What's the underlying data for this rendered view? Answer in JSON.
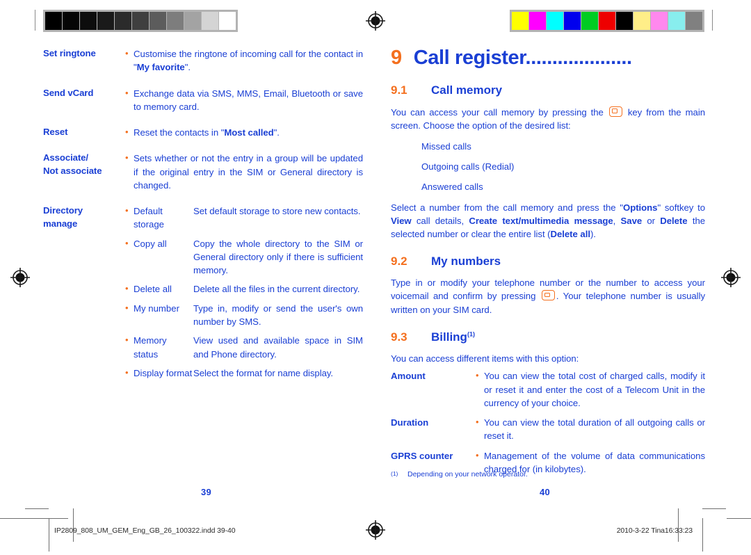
{
  "document": {
    "type": "print-proof-spread",
    "left_page_number": "39",
    "right_page_number": "40"
  },
  "calibration": {
    "grayscale_label": "grayscale-calibration-strip",
    "grayscale_swatches": [
      "#000000",
      "#050505",
      "#0d0d0d",
      "#1a1a1a",
      "#2b2b2b",
      "#3f3f3f",
      "#5c5c5c",
      "#7d7d7d",
      "#a3a3a3",
      "#d4d4d4",
      "#ffffff"
    ],
    "color_label": "color-calibration-strip",
    "color_swatches": [
      "#ffff00",
      "#ff00ff",
      "#00ffff",
      "#0000ee",
      "#00cc22",
      "#ee0000",
      "#000000",
      "#ffee88",
      "#ff88ee",
      "#88eeee",
      "#808080"
    ]
  },
  "left_page": {
    "rows": [
      {
        "term": [
          "Set ringtone"
        ],
        "bullets": [
          {
            "text_html": "Customise the ringtone of incoming call for the contact in \"<b>My favorite</b>\"."
          }
        ]
      },
      {
        "term": [
          "Send vCard"
        ],
        "bullets": [
          {
            "text_html": "Exchange data via SMS, MMS, Email, Bluetooth or save to memory card."
          }
        ]
      },
      {
        "term": [
          "Reset"
        ],
        "bullets": [
          {
            "text_html": "Reset the contacts in \"<b>Most called</b>\"."
          }
        ]
      },
      {
        "term": [
          "Associate/",
          "Not associate"
        ],
        "bullets": [
          {
            "text_html": "Sets whether or not the entry in a group will be updated if the original entry in the SIM or General directory is changed."
          }
        ]
      },
      {
        "term": [
          "Directory",
          "manage"
        ],
        "subitems": [
          {
            "label": "Default storage",
            "text": "Set default storage to store new contacts."
          },
          {
            "label": "Copy all",
            "text": "Copy the whole directory to the SIM or General directory only if there is sufficient memory."
          },
          {
            "label": "Delete all",
            "text": "Delete all the files in the current directory."
          },
          {
            "label": "My number",
            "text": "Type in, modify or send the user's own number by SMS."
          },
          {
            "label": "Memory status",
            "text": "View used and available space in SIM and Phone directory."
          },
          {
            "label": "Display format",
            "text": "Select the format for name display."
          }
        ]
      }
    ]
  },
  "right_page": {
    "chapter": {
      "number": "9",
      "title": "Call register...................."
    },
    "sections": [
      {
        "number": "9.1",
        "title": "Call memory",
        "intro_before_icon": "You can access your call memory by pressing the ",
        "intro_after_icon": " key from the main screen. Choose the option of the desired list:",
        "list": [
          "Missed calls",
          "Outgoing calls (Redial)",
          "Answered calls"
        ],
        "outro_html": "Select a number from the call memory and press the \"<b>Options</b>\" softkey to <b>View</b> call details, <b>Create text/multimedia message</b>, <b>Save</b> or <b>Delete</b> the selected number or clear the entire list (<b>Delete all</b>)."
      },
      {
        "number": "9.2",
        "title": "My numbers",
        "body_before_icon": "Type in or modify your telephone number or the number to access your voicemail and confirm by pressing ",
        "body_after_icon": ". Your telephone number is usually written on your SIM card."
      },
      {
        "number": "9.3",
        "title": "Billing",
        "title_footnote": "(1)",
        "intro": "You can access different items with this option:",
        "rows": [
          {
            "term": "Amount",
            "text": "You can view the total cost of charged calls, modify it or reset it and enter the cost of a Telecom Unit in the currency of your choice."
          },
          {
            "term": "Duration",
            "text": "You can view the total duration of all outgoing calls or reset it."
          },
          {
            "term": "GPRS counter",
            "text": "Management of the volume of data communications charged for (in kilobytes)."
          }
        ]
      }
    ],
    "footnote": {
      "mark": "(1)",
      "text": "Depending on your network operator."
    }
  },
  "footer": {
    "file_name": "IP2809_808_UM_GEM_Eng_GB_26_100322.indd   39-40",
    "date_stamp": "2010-3-22   Tina16:33:23"
  },
  "colors": {
    "blue": "#1a3fd4",
    "orange": "#f4701f",
    "black": "#2b2b2b"
  }
}
